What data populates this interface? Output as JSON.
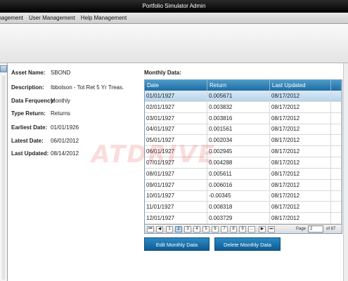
{
  "window": {
    "title": "Portfolio Simulator Admin"
  },
  "menu": {
    "items": [
      "anagement",
      "User Management",
      "Help Management"
    ]
  },
  "asset": {
    "fields": [
      {
        "label": "Asset Name:",
        "value": "SBOND"
      },
      {
        "label": "Description:",
        "value": "Ibbotson - Tot Ret 5 Yr Treas."
      },
      {
        "label": "Data Ferquency:",
        "value": "Monthly"
      },
      {
        "label": "Type Return:",
        "value": "Returns"
      },
      {
        "label": "Earliest Date:",
        "value": "01/01/1926"
      },
      {
        "label": "Latest Date:",
        "value": "06/01/2012"
      },
      {
        "label": "Last Updated:",
        "value": "08/14/2012"
      }
    ]
  },
  "monthly": {
    "heading": "Monthly Data:",
    "columns": [
      "Date",
      "Return",
      "Last Updated"
    ],
    "selected_row": 0,
    "rows": [
      [
        "01/01/1927",
        "0.005671",
        "08/17/2012"
      ],
      [
        "02/01/1927",
        "0.003832",
        "08/17/2012"
      ],
      [
        "03/01/1927",
        "0.003816",
        "08/17/2012"
      ],
      [
        "04/01/1927",
        "0.001561",
        "08/17/2012"
      ],
      [
        "05/01/1927",
        "0.002034",
        "08/17/2012"
      ],
      [
        "06/01/1927",
        "0.002945",
        "08/17/2012"
      ],
      [
        "07/01/1927",
        "0.004288",
        "08/17/2012"
      ],
      [
        "08/01/1927",
        "0.005611",
        "08/17/2012"
      ],
      [
        "09/01/1927",
        "0.006016",
        "08/17/2012"
      ],
      [
        "10/01/1927",
        "-0.00345",
        "08/17/2012"
      ],
      [
        "11/01/1927",
        "0.008318",
        "08/17/2012"
      ],
      [
        "12/01/1927",
        "0.003729",
        "08/17/2012"
      ]
    ],
    "pager": {
      "first": "⏮",
      "prev": "◀",
      "next": "▶",
      "last": "⏭",
      "pages": [
        "1",
        "2",
        "3",
        "4",
        "5",
        "6",
        "7",
        "8",
        "9",
        "..."
      ],
      "current_page": "2",
      "page_label": "Page",
      "page_value": "2",
      "of_label": "of 87"
    }
  },
  "actions": {
    "edit": "Edit Monthly Data",
    "delete": "Delete Monthly Data"
  },
  "watermark": {
    "text": "ATDRIVE"
  },
  "colors": {
    "header": "#2a7fb3",
    "button": "#1a6fa8",
    "selected": "#c6ddf0"
  }
}
